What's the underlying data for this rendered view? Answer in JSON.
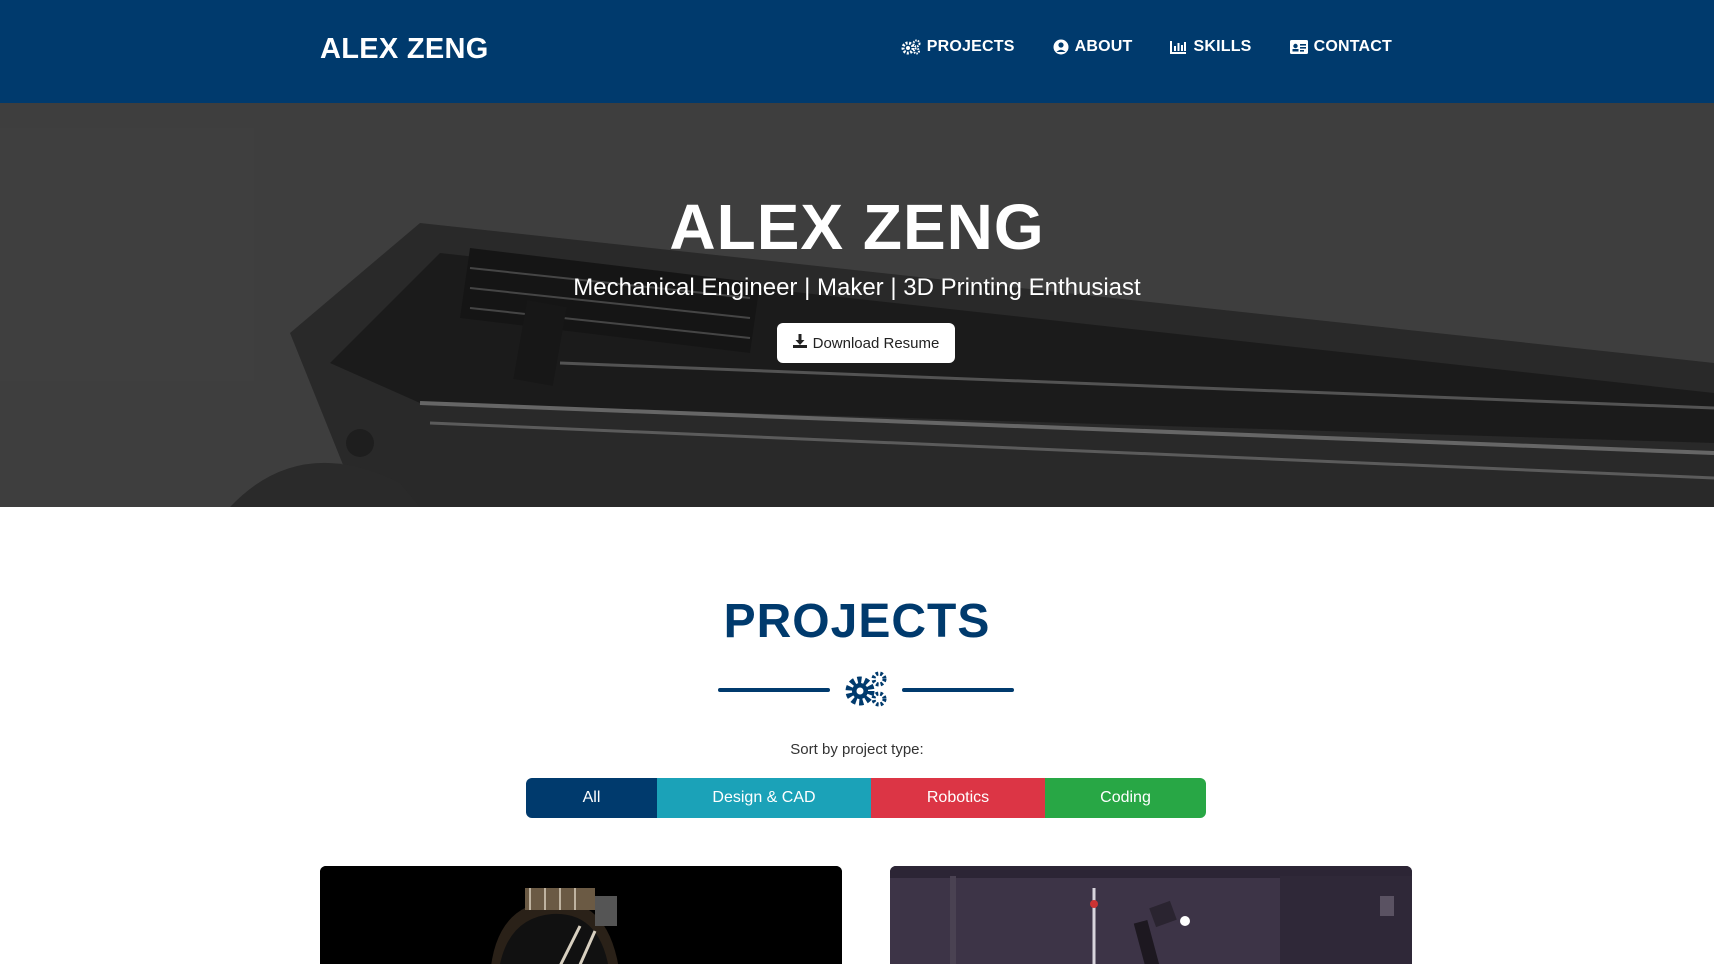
{
  "nav": {
    "brand": "ALEX ZENG",
    "links": [
      {
        "label": "PROJECTS",
        "icon": "gears-icon"
      },
      {
        "label": "ABOUT",
        "icon": "user-circle-icon"
      },
      {
        "label": "SKILLS",
        "icon": "bar-chart-icon"
      },
      {
        "label": "CONTACT",
        "icon": "id-card-icon"
      }
    ]
  },
  "hero": {
    "title": "ALEX ZENG",
    "subtitle": "Mechanical Engineer | Maker | 3D Printing Enthusiast",
    "resume_button": "Download Resume",
    "resume_icon": "download-icon"
  },
  "projects": {
    "title": "PROJECTS",
    "divider_icon": "gears-icon",
    "sort_label": "Sort by project type:",
    "filters": [
      {
        "label": "All",
        "color": "#003a6d"
      },
      {
        "label": "Design & CAD",
        "color": "#1ba2b8"
      },
      {
        "label": "Robotics",
        "color": "#dc3545"
      },
      {
        "label": "Coding",
        "color": "#28a745"
      }
    ]
  },
  "colors": {
    "primary": "#003a6d",
    "white": "#ffffff"
  }
}
